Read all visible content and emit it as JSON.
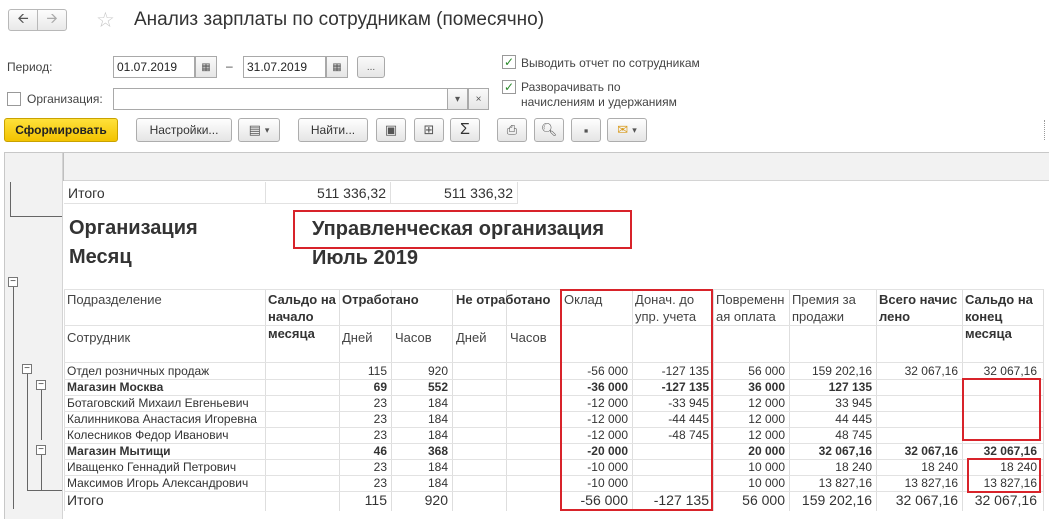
{
  "window": {
    "title": "Анализ зарплаты по сотрудникам (помесячно)"
  },
  "nav": {
    "back_icon": "arrow-left-icon",
    "forward_icon": "arrow-right-icon",
    "favorite_icon": "star-icon"
  },
  "form": {
    "period_label": "Период:",
    "date_from": "01.07.2019",
    "dash": "–",
    "date_to": "31.07.2019",
    "period_button": "...",
    "org_label": "Организация:",
    "org_value": "",
    "org_clear": "×",
    "opt1_label": "Выводить отчет по сотрудникам",
    "opt1_checked": true,
    "opt2_label_line1": "Разворачивать по",
    "opt2_label_line2": "начислениям и удержаниям",
    "opt2_checked": true
  },
  "toolbar": {
    "generate_label": "Сформировать",
    "settings_label": "Настройки...",
    "find_label": "Найти...",
    "sigma": "Σ"
  },
  "report": {
    "top_total_label": "Итого",
    "top_total_1": "511 336,32",
    "top_total_2": "511 336,32",
    "org_heading": "Организация",
    "org_name": "Управленческая организация",
    "month_heading": "Месяц",
    "month_value": "Июль 2019",
    "headers": {
      "subdivision": "Подразделение",
      "employee": "Сотрудник",
      "saldo_start": "Сальдо на начало месяца",
      "worked": "Отработано",
      "worked_days": "Дней",
      "worked_hours": "Часов",
      "not_worked": "Не отработано",
      "not_worked_days": "Дней",
      "not_worked_hours": "Часов",
      "salary": "Оклад",
      "extra": "Донач. до упр. учета",
      "hourly": "Повременная оплата",
      "bonus": "Премия за продажи",
      "total_accrued": "Всего начислено",
      "saldo_end": "Сальдо на конец месяца"
    },
    "rows": [
      {
        "name": "Отдел розничных продаж",
        "bold": false,
        "days": "115",
        "hours": "920",
        "salary": "-56 000",
        "extra": "-127 135",
        "hourly": "56 000",
        "bonus": "159 202,16",
        "total": "32 067,16",
        "end": "32 067,16"
      },
      {
        "name": "Магазин Москва",
        "bold": true,
        "days": "69",
        "hours": "552",
        "salary": "-36 000",
        "extra": "-127 135",
        "hourly": "36 000",
        "bonus": "127 135",
        "total": "",
        "end": ""
      },
      {
        "name": "Ботаговский Михаил Евгеньевич",
        "bold": false,
        "days": "23",
        "hours": "184",
        "salary": "-12 000",
        "extra": "-33 945",
        "hourly": "12 000",
        "bonus": "33 945",
        "total": "",
        "end": ""
      },
      {
        "name": "Калинникова Анастасия Игоревна",
        "bold": false,
        "days": "23",
        "hours": "184",
        "salary": "-12 000",
        "extra": "-44 445",
        "hourly": "12 000",
        "bonus": "44 445",
        "total": "",
        "end": ""
      },
      {
        "name": "Колесников Федор Иванович",
        "bold": false,
        "days": "23",
        "hours": "184",
        "salary": "-12 000",
        "extra": "-48 745",
        "hourly": "12 000",
        "bonus": "48 745",
        "total": "",
        "end": ""
      },
      {
        "name": "Магазин Мытищи",
        "bold": true,
        "days": "46",
        "hours": "368",
        "salary": "-20 000",
        "extra": "",
        "hourly": "20 000",
        "bonus": "32 067,16",
        "total": "32 067,16",
        "end": "32 067,16"
      },
      {
        "name": "Иващенко Геннадий Петрович",
        "bold": false,
        "days": "23",
        "hours": "184",
        "salary": "-10 000",
        "extra": "",
        "hourly": "10 000",
        "bonus": "18 240",
        "total": "18 240",
        "end": "18 240"
      },
      {
        "name": "Максимов Игорь Александрович",
        "bold": false,
        "days": "23",
        "hours": "184",
        "salary": "-10 000",
        "extra": "",
        "hourly": "10 000",
        "bonus": "13 827,16",
        "total": "13 827,16",
        "end": "13 827,16"
      }
    ],
    "total": {
      "name": "Итого",
      "days": "115",
      "hours": "920",
      "salary": "-56 000",
      "extra": "-127 135",
      "hourly": "56 000",
      "bonus": "159 202,16",
      "total": "32 067,16",
      "end": "32 067,16"
    }
  },
  "colors": {
    "highlight": "#d8232a",
    "primary_button": "#f3c300",
    "check": "#2a8a2a"
  }
}
